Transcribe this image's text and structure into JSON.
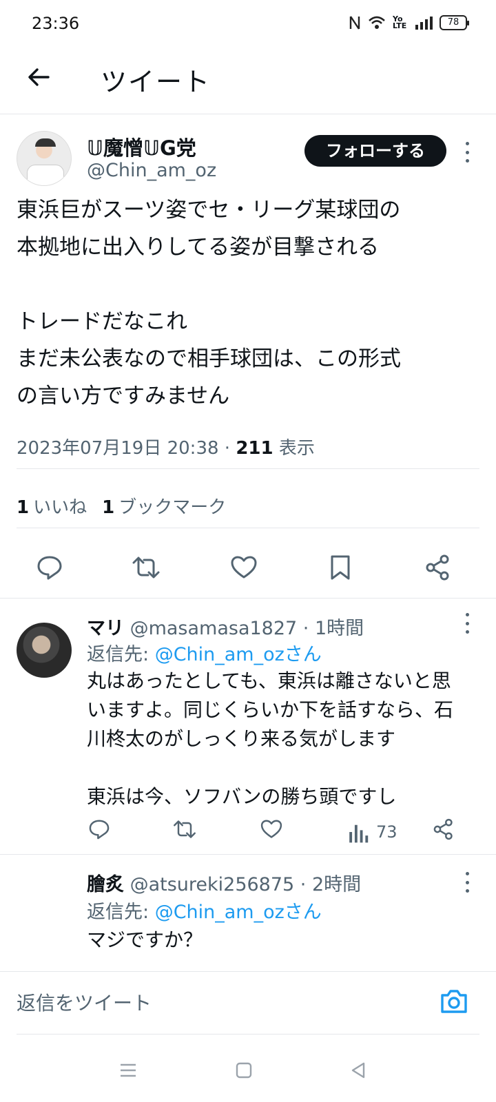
{
  "status": {
    "time": "23:36",
    "battery": "78",
    "network": "Yo LTE"
  },
  "header": {
    "title": "ツイート"
  },
  "tweet": {
    "name": "𝕌魔憎𝕌G党",
    "handle": "@Chin_am_oz",
    "follow_label": "フォローする",
    "text": "東浜巨がスーツ姿でセ・リーグ某球団の\n本拠地に出入りしてる姿が目撃される\n\nトレードだなこれ\nまだ未公表なので相手球団は、この形式\nの言い方ですみません",
    "date": "2023年07月19日 20:38 · ",
    "views_count": "211",
    "views_label": " 表示",
    "likes_count": "1",
    "likes_label": "いいね",
    "bookmarks_count": "1",
    "bookmarks_label": "ブックマーク"
  },
  "replies": [
    {
      "name": "マリ",
      "meta": " @masamasa1827 · 1時間",
      "reply_to_prefix": "返信先: ",
      "reply_to_handle": "@Chin_am_ozさん",
      "text": "丸はあったとしても、東浜は離さないと思\nいますよ。同じくらいか下を話すなら、石\n川柊太のがしっくり来る気がします\n\n東浜は今、ソフバンの勝ち頭ですし",
      "views": "73"
    },
    {
      "name": "膾炙",
      "meta": " @atsureki256875 · 2時間",
      "reply_to_prefix": "返信先: ",
      "reply_to_handle": "@Chin_am_ozさん",
      "text": "マジですか？"
    }
  ],
  "composer": {
    "placeholder": "返信をツイート"
  },
  "colors": {
    "accent": "#1d9bf0",
    "text": "#0f1419",
    "muted": "#536471"
  },
  "icons": [
    "back-arrow-icon",
    "reply-icon",
    "retweet-icon",
    "like-icon",
    "bookmark-icon",
    "share-icon",
    "views-icon",
    "camera-icon",
    "more-icon"
  ]
}
